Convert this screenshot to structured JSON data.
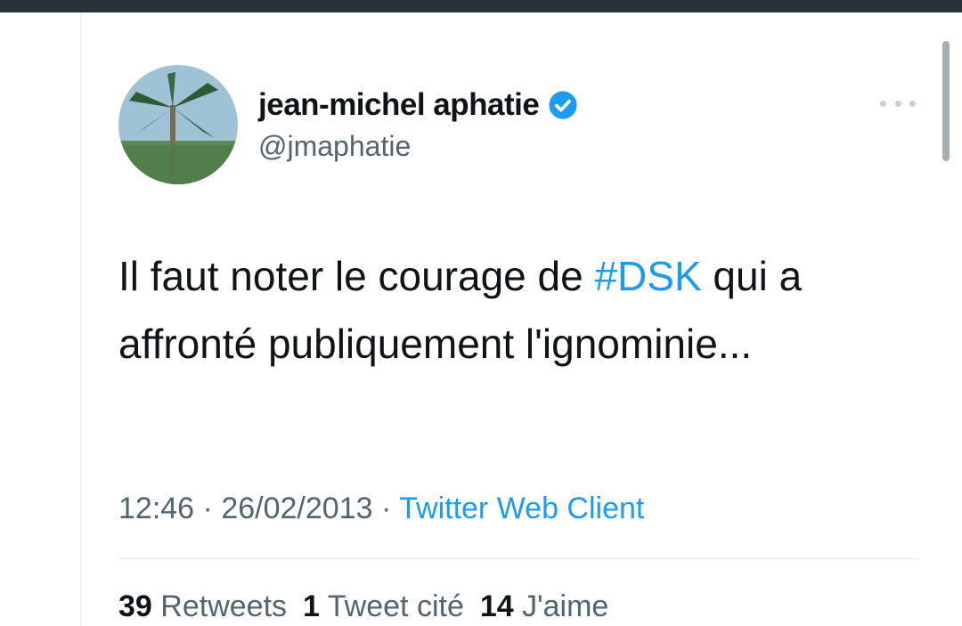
{
  "tweet": {
    "display_name": "jean-michel aphatie",
    "handle": "@jmaphatie",
    "text_part1": "Il faut noter le courage de ",
    "hashtag": "#DSK",
    "text_part2": " qui a affronté publiquement l'ignominie...",
    "time": "12:46",
    "separator": "·",
    "date": "26/02/2013",
    "source": "Twitter Web Client",
    "retweets_count": "39",
    "retweets_label": "Retweets",
    "quotes_count": "1",
    "quotes_label": "Tweet cité",
    "likes_count": "14",
    "likes_label": "J'aime"
  },
  "icons": {
    "verified": "verified-badge-icon",
    "more": "more-options-icon"
  },
  "colors": {
    "accent": "#1d9bf0",
    "text": "#0f1419",
    "muted": "#536471",
    "topbar": "#263238"
  }
}
